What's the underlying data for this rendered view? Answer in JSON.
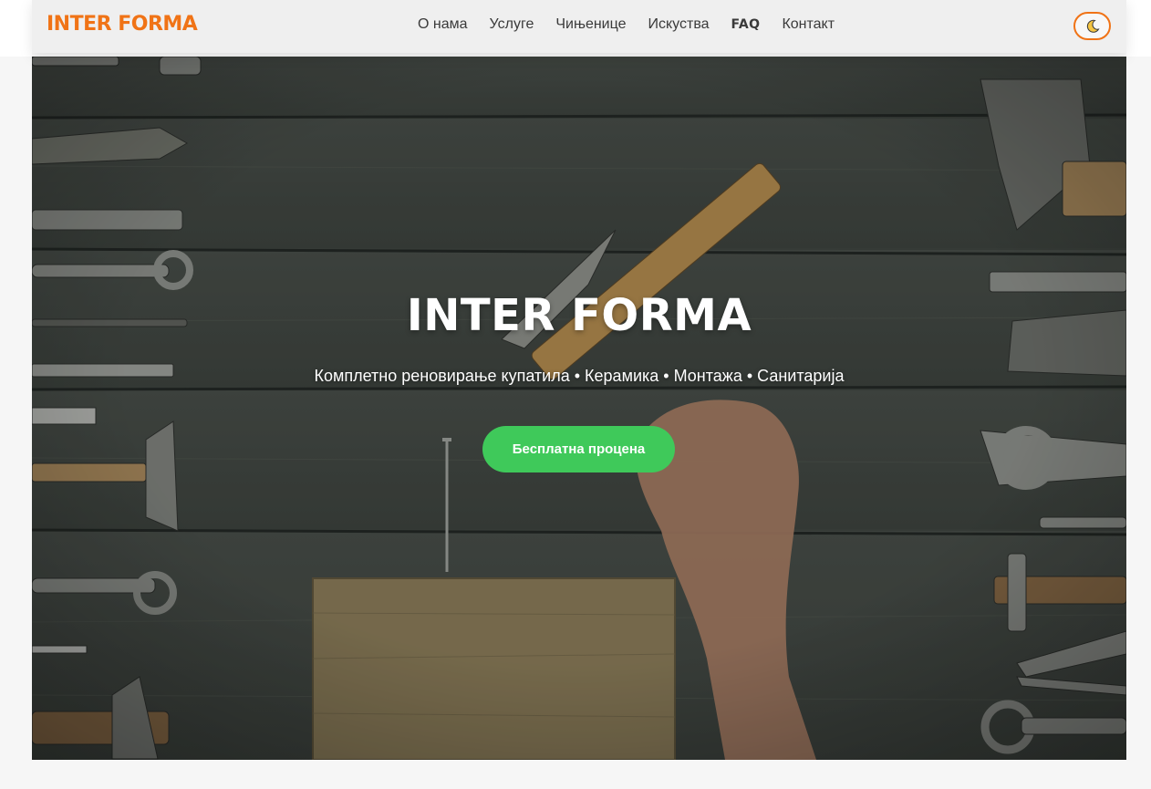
{
  "header": {
    "logo": "INTER FORMA",
    "nav": [
      {
        "label": "О нама"
      },
      {
        "label": "Услуге"
      },
      {
        "label": "Чињенице"
      },
      {
        "label": "Искуства"
      },
      {
        "label": "FAQ"
      },
      {
        "label": "Контакт"
      }
    ],
    "theme_toggle_icon": "moon-icon"
  },
  "hero": {
    "title": "INTER FORMA",
    "subtitle": "Комплетно реновирање купатила • Керамика • Монтажа • Санитарија",
    "cta_label": "Бесплатна процена",
    "background": "tools-on-wooden-table-photo"
  },
  "colors": {
    "brand": "#f07316",
    "cta": "#3fc95a",
    "hero_bg": "#3c423d",
    "header_bg": "#efefef"
  }
}
